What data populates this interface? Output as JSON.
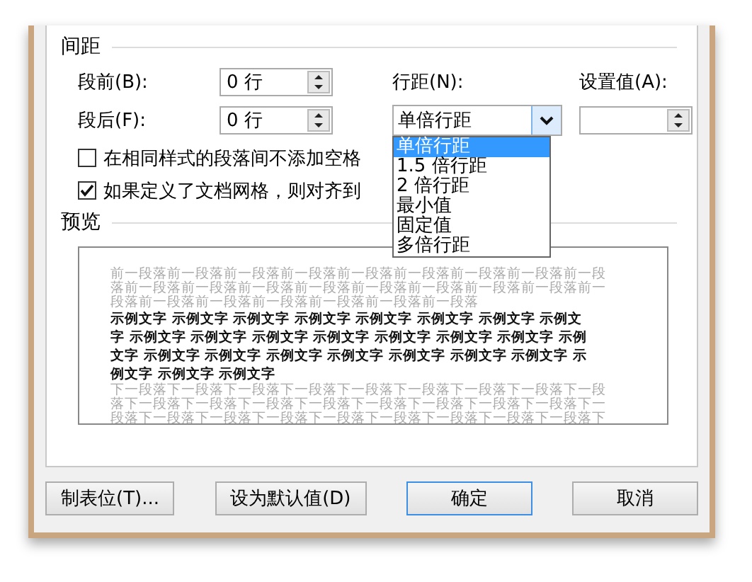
{
  "spacing": {
    "title": "间距",
    "before": {
      "label": "段前(B):",
      "value": "0 行"
    },
    "after": {
      "label": "段后(F):",
      "value": "0 行"
    },
    "line_spacing": {
      "label": "行距(N):",
      "value": "单倍行距",
      "expanded": true,
      "options": [
        {
          "label": "单倍行距",
          "selected": true
        },
        {
          "label": "1.5 倍行距",
          "selected": false
        },
        {
          "label": "2 倍行距",
          "selected": false
        },
        {
          "label": "最小值",
          "selected": false
        },
        {
          "label": "固定值",
          "selected": false
        },
        {
          "label": "多倍行距",
          "selected": false
        }
      ]
    },
    "setting": {
      "label": "设置值(A):"
    },
    "checkboxes": [
      {
        "label": "在相同样式的段落间不添加空格",
        "checked": false
      },
      {
        "label": "如果定义了文档网格，则对齐到",
        "checked": true
      }
    ]
  },
  "preview": {
    "title": "预览",
    "lines": [
      {
        "kind": "previous",
        "text": "前一段落前一段落前一段落前一段落前一段落前一段落前一段落前一段落前一段"
      },
      {
        "kind": "previous",
        "text": "落前一段落前一段落前一段落前一段落前一段落前一段落前一段落前一段落前一"
      },
      {
        "kind": "previous",
        "text": "段落前一段落前一段落前一段落前一段落前一段落前一段落"
      },
      {
        "kind": "sample",
        "text": "示例文字 示例文字 示例文字 示例文字 示例文字 示例文字 示例文字 示例文"
      },
      {
        "kind": "sample",
        "text": "字 示例文字 示例文字 示例文字 示例文字 示例文字 示例文字 示例文字 示例"
      },
      {
        "kind": "sample",
        "text": "文字 示例文字 示例文字 示例文字 示例文字 示例文字 示例文字 示例文字 示"
      },
      {
        "kind": "sample",
        "text": "例文字 示例文字 示例文字"
      },
      {
        "kind": "next",
        "text": "下一段落下一段落下一段落下一段落下一段落下一段落下一段落下一段落下一段"
      },
      {
        "kind": "next",
        "text": "落下一段落下一段落下一段落下一段落下一段落下一段落下一段落下一段落下一"
      },
      {
        "kind": "next",
        "text": "段落下一段落下一段落下一段落下一段落下一段落下一段落下一段落下一段落下"
      }
    ]
  },
  "buttons": [
    {
      "label": "制表位(T)...",
      "default": false
    },
    {
      "label": "设为默认值(D)",
      "default": false
    },
    {
      "label": "确定",
      "default": true
    },
    {
      "label": "取消",
      "default": false
    }
  ]
}
